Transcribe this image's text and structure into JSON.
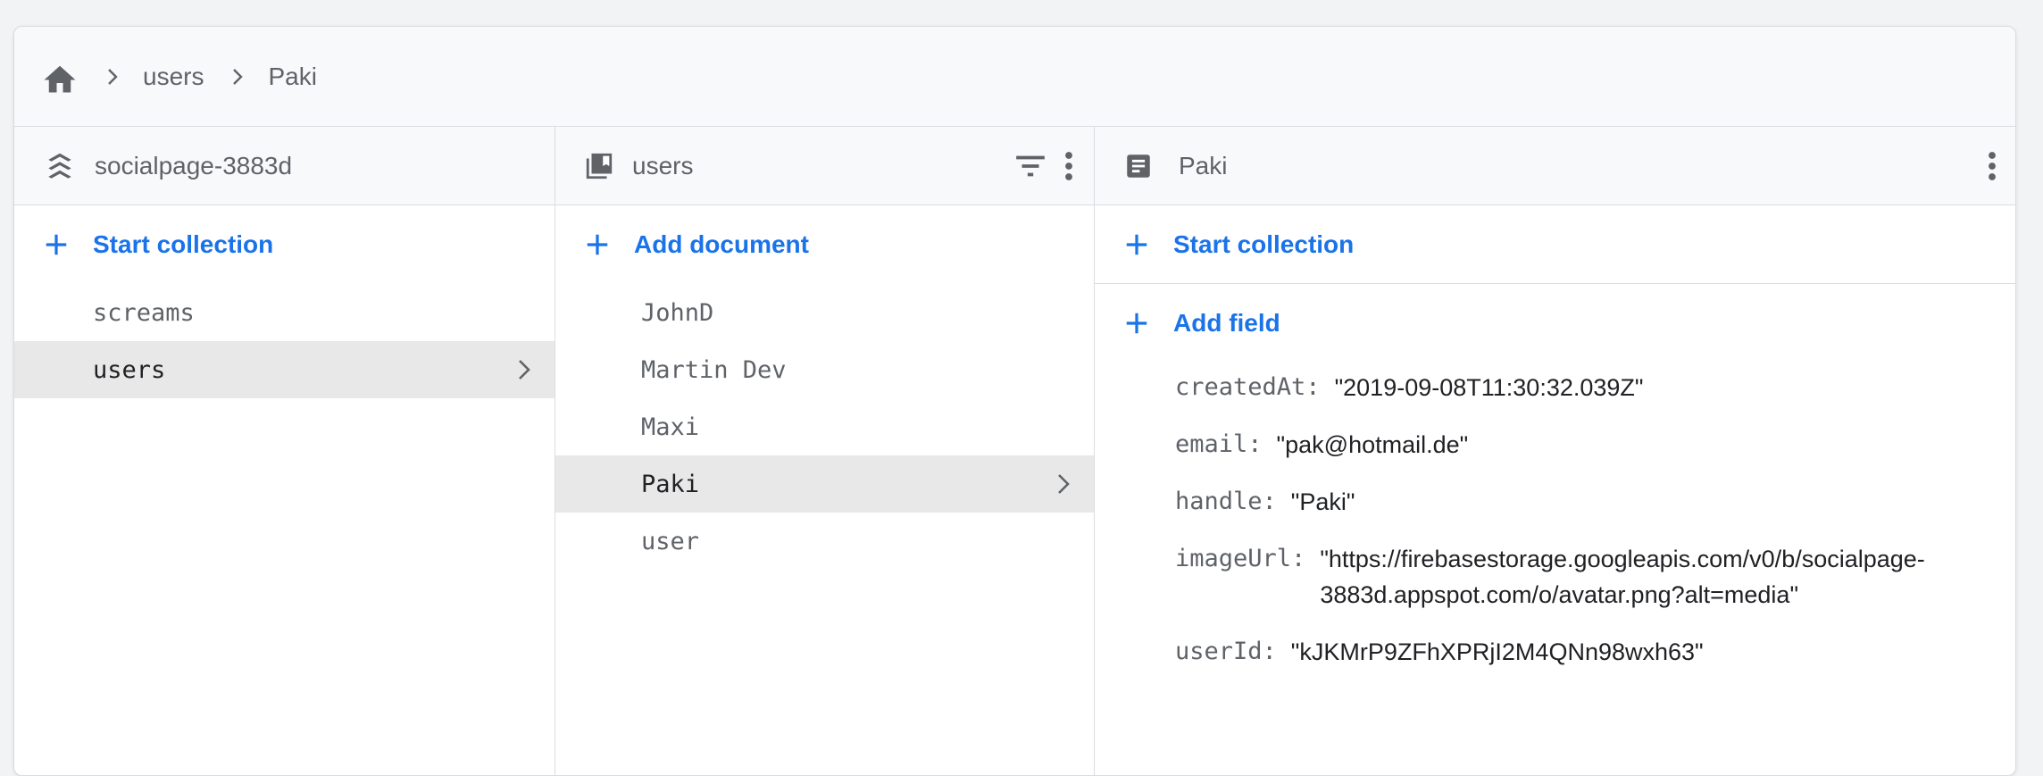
{
  "breadcrumb": {
    "home_icon": "home-icon",
    "items": [
      "users",
      "Paki"
    ]
  },
  "panels": {
    "root": {
      "title": "socialpage-3883d",
      "icon": "firestore-database-icon",
      "action_label": "Start collection",
      "items": [
        {
          "label": "screams",
          "selected": false
        },
        {
          "label": "users",
          "selected": true
        }
      ]
    },
    "collection": {
      "title": "users",
      "icon": "collection-icon",
      "action_label": "Add document",
      "items": [
        {
          "label": "JohnD",
          "selected": false
        },
        {
          "label": "Martin Dev",
          "selected": false
        },
        {
          "label": "Maxi",
          "selected": false
        },
        {
          "label": "Paki",
          "selected": true
        },
        {
          "label": "user",
          "selected": false
        }
      ]
    },
    "document": {
      "title": "Paki",
      "icon": "document-icon",
      "start_collection_label": "Start collection",
      "add_field_label": "Add field",
      "fields": [
        {
          "key": "createdAt:",
          "value": "\"2019-09-08T11:30:32.039Z\""
        },
        {
          "key": "email:",
          "value": "\"pak@hotmail.de\""
        },
        {
          "key": "handle:",
          "value": "\"Paki\""
        },
        {
          "key": "imageUrl:",
          "value": "\"https://firebasestorage.googleapis.com/v0/b/socialpage-3883d.appspot.com/o/avatar.png?alt=media\""
        },
        {
          "key": "userId:",
          "value": "\"kJKMrP9ZFhXPRjI2M4QNn98wxh63\""
        }
      ]
    }
  },
  "colors": {
    "accent": "#1a73e8",
    "muted_text": "#5f6368",
    "selected_bg": "#e8e8e8"
  }
}
